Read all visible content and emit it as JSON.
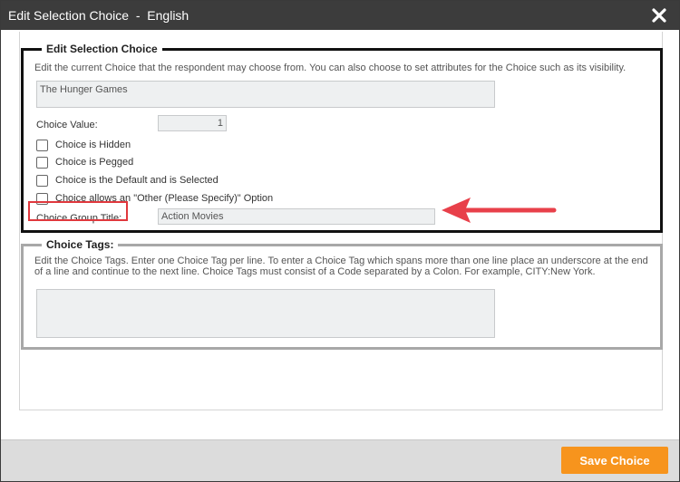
{
  "dialog": {
    "title": "Edit Selection Choice  -  English",
    "close_icon": "close-icon"
  },
  "choice_section": {
    "legend": "Edit Selection Choice",
    "description": "Edit the current Choice that the respondent may choose from. You can also choose to set attributes for the Choice such as its visibility.",
    "choice_text": "The Hunger Games",
    "choice_value_label": "Choice Value:",
    "choice_value": "1",
    "checkboxes": [
      {
        "label": "Choice is Hidden",
        "checked": false
      },
      {
        "label": "Choice is Pegged",
        "checked": false
      },
      {
        "label": "Choice is the Default and is Selected",
        "checked": false
      },
      {
        "label": "Choice allows an \"Other (Please Specify)\" Option",
        "checked": false
      }
    ],
    "group_title_label": "Choice Group Title:",
    "group_title_value": "Action Movies"
  },
  "tags_section": {
    "legend": "Choice Tags:",
    "description": "Edit the Choice Tags. Enter one Choice Tag per line. To enter a Choice Tag which spans more than one line place an underscore at the end of a line and continue to the next line. Choice Tags must consist of a Code separated by a Colon. For example, CITY:New York.",
    "tags_value": ""
  },
  "footer": {
    "save_label": "Save Choice"
  },
  "colors": {
    "titlebar": "#3c3c3c",
    "save_button": "#f7941d",
    "highlight": "#e0383d",
    "arrow": "#e8404a"
  }
}
